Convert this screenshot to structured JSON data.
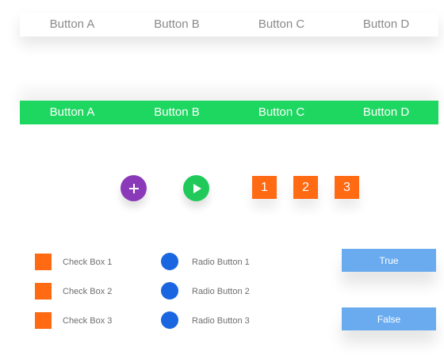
{
  "colors": {
    "green": "#1ed760",
    "purple": "#8a3ab9",
    "play_green": "#20c95a",
    "orange": "#ff6a13",
    "blue": "#1a66e0",
    "light_blue": "#6aabf0",
    "gray_text": "#8a8a8a"
  },
  "bar_top": {
    "buttons": [
      "Button A",
      "Button B",
      "Button C",
      "Button D"
    ]
  },
  "bar_green": {
    "buttons": [
      "Button A",
      "Button B",
      "Button C",
      "Button D"
    ]
  },
  "icons": {
    "plus": "plus-icon",
    "play": "play-icon"
  },
  "numbers": [
    "1",
    "2",
    "3"
  ],
  "checkboxes": [
    "Check Box 1",
    "Check Box 2",
    "Check Box 3"
  ],
  "radios": [
    "Radio Button 1",
    "Radio Button 2",
    "Radio Button 3"
  ],
  "bool_buttons": {
    "true_label": "True",
    "false_label": "False"
  }
}
